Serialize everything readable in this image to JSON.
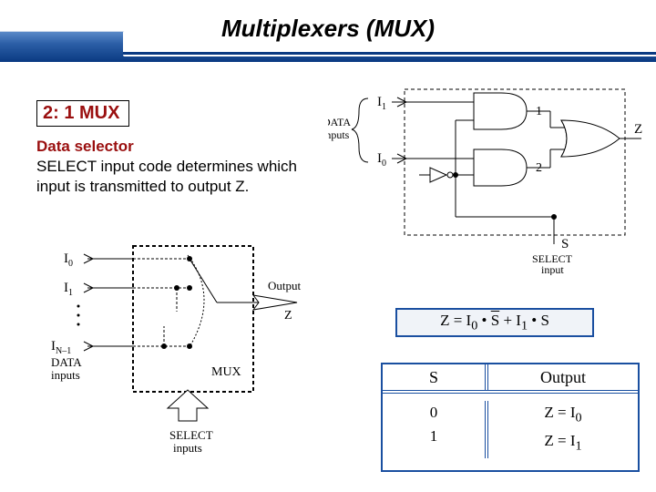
{
  "slide": {
    "title": "Multiplexers (MUX)",
    "section": "2: 1 MUX",
    "desc_strong": "Data selector",
    "desc_rest": "SELECT input code determines which input is transmitted to output Z."
  },
  "fig1": {
    "i0": "I",
    "i0sub": "0",
    "i1": "I",
    "i1sub": "1",
    "in": "I",
    "insub": "N–1",
    "data_label1": "DATA",
    "data_label2": "inputs",
    "out1": "Output",
    "out2": "Z",
    "mux": "MUX",
    "sel1": "SELECT",
    "sel2": "inputs"
  },
  "fig2": {
    "i1": "I",
    "i1sub": "1",
    "i0": "I",
    "i0sub": "0",
    "data1": "DATA",
    "data2": "inputs",
    "gate1": "1",
    "gate2": "2",
    "z": "Z",
    "s": "S",
    "sel1": "SELECT",
    "sel2": "input"
  },
  "eq": {
    "text": "Z = I₀ • S̄ + I₁ • S"
  },
  "truth": {
    "h1": "S",
    "h2": "Output",
    "r1c1": "0",
    "r1c2": "Z = I₀",
    "r2c1": "1",
    "r2c2": "Z = I₁"
  }
}
